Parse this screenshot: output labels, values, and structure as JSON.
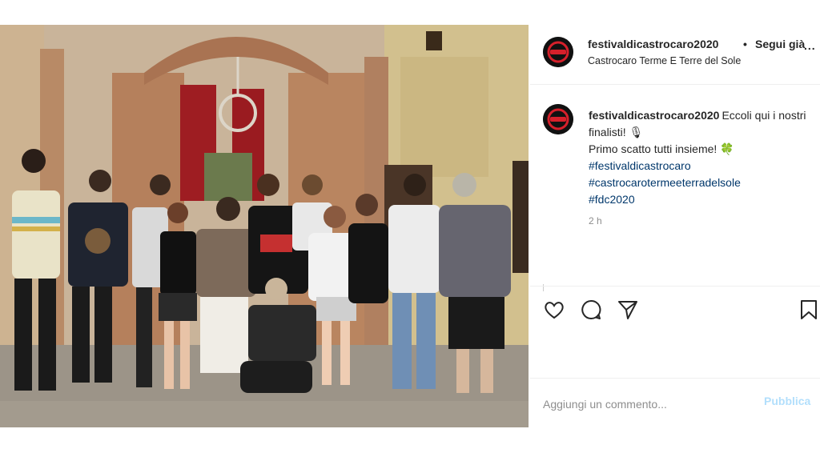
{
  "post": {
    "username": "festivaldicastrocaro2020",
    "separator": "•",
    "follow_label": "Segui già",
    "more_label": "...",
    "location": "Castrocaro Terme E Terre del Sole",
    "caption": {
      "line1": "Eccoli qui i nostri finalisti! 🎙",
      "line2": "Primo scatto tutti insieme! 🍀",
      "hashtags": [
        "#festivaldicastrocaro",
        "#castrocarotermeeterradelsole",
        "#fdc2020"
      ]
    },
    "time_ago": "2 h",
    "actions": {
      "like": "heart-icon",
      "comment": "comment-icon",
      "share": "paper-plane-icon",
      "save": "bookmark-icon"
    },
    "comment_placeholder": "Aggiungi un commento...",
    "publish_label": "Pubblica",
    "colors": {
      "hashtag": "#00376b",
      "publish": "#b2dffc",
      "muted": "#8e8e8e",
      "avatar_accent": "#d6202b"
    }
  }
}
